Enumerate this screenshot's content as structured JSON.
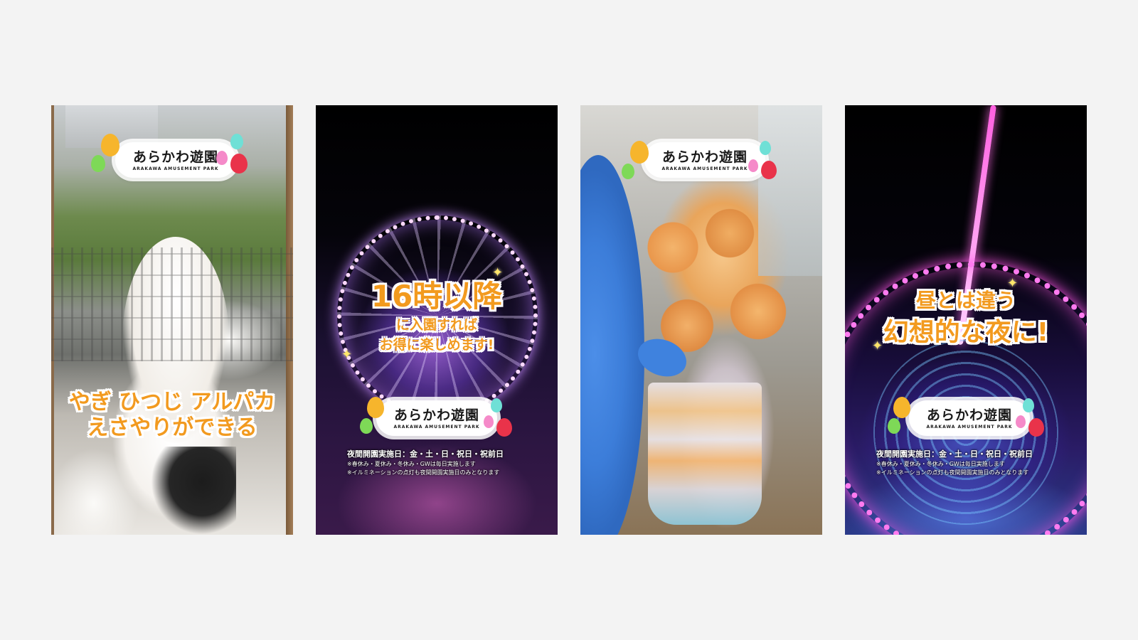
{
  "brand": {
    "logo_name": "あらかわ遊園",
    "logo_sub": "ARAKAWA AMUSEMENT PARK"
  },
  "cards": [
    {
      "caption_lines": [
        "やぎ ひつじ アルパカ",
        "えさやりができる"
      ]
    },
    {
      "caption_lines": [
        "16時以降",
        "に入園すれば",
        "お得に楽しめます!"
      ],
      "info_main": "夜間開園実施日：金・土・日・祝日・祝前日",
      "info_notes": [
        "※春休み・夏休み・冬休み・GWは毎日実施します",
        "※イルミネーションの点灯も夜間開園実施日のみとなります"
      ]
    },
    {
      "caption_lines": []
    },
    {
      "caption_lines": [
        "昼とは違う",
        "幻想的な夜に!"
      ],
      "info_main": "夜間開園実施日：金・土・日・祝日・祝前日",
      "info_notes": [
        "※春休み・夏休み・冬休み・GWは毎日実施します",
        "※イルミネーションの点灯も夜間開園実施日のみとなります"
      ]
    }
  ],
  "icons": [
    "balloon-icon",
    "sparkle-icon"
  ],
  "colors": {
    "page_bg": "#f3f3f3",
    "caption_orange": "#f29a1f",
    "caption_outline": "#ffffff",
    "balloon_orange": "#f6b52c",
    "balloon_green": "#7ed957",
    "balloon_pink": "#f58ac9",
    "balloon_red": "#e9334a",
    "balloon_teal": "#6fe0d6"
  }
}
